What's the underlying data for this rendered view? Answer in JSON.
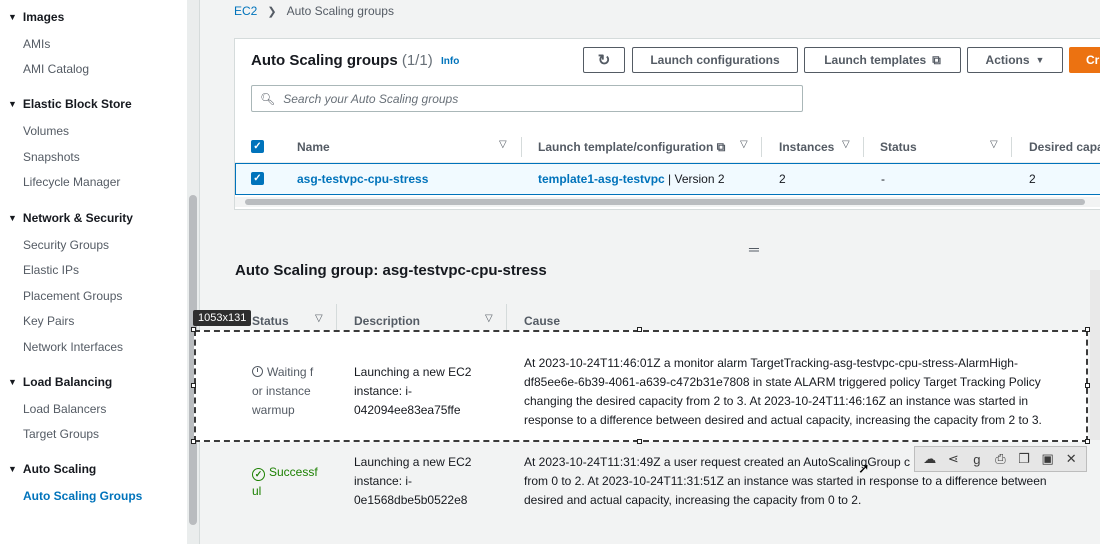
{
  "sidebar": {
    "sections": [
      {
        "label": "Images",
        "items": [
          "AMIs",
          "AMI Catalog"
        ]
      },
      {
        "label": "Elastic Block Store",
        "items": [
          "Volumes",
          "Snapshots",
          "Lifecycle Manager"
        ]
      },
      {
        "label": "Network & Security",
        "items": [
          "Security Groups",
          "Elastic IPs",
          "Placement Groups",
          "Key Pairs",
          "Network Interfaces"
        ]
      },
      {
        "label": "Load Balancing",
        "items": [
          "Load Balancers",
          "Target Groups"
        ]
      },
      {
        "label": "Auto Scaling",
        "items": [
          "Auto Scaling Groups"
        ]
      }
    ]
  },
  "breadcrumb": {
    "root": "EC2",
    "current": "Auto Scaling groups"
  },
  "panel": {
    "title": "Auto Scaling groups",
    "count": "(1/1)",
    "info": "Info",
    "buttons": {
      "launch_configurations": "Launch configurations",
      "launch_templates": "Launch templates",
      "actions": "Actions",
      "create": "Cr"
    },
    "search_placeholder": "Search your Auto Scaling groups",
    "columns": [
      "Name",
      "Launch template/configuration",
      "Instances",
      "Status",
      "Desired capa"
    ],
    "row": {
      "name": "asg-testvpc-cpu-stress",
      "template": "template1-asg-testvpc",
      "version": " | Version 2",
      "instances": "2",
      "status": "-",
      "desired": "2"
    }
  },
  "detail": {
    "title": "Auto Scaling group: asg-testvpc-cpu-stress",
    "columns": [
      "Status",
      "Description",
      "Cause"
    ],
    "rows": [
      {
        "status_lines": [
          "Waiting f",
          "or instance",
          "warmup"
        ],
        "description_lines": [
          "Launching a new EC2",
          "instance: i-",
          "042094ee83ea75ffe"
        ],
        "cause_lines": [
          "At 2023-10-24T11:46:01Z a monitor alarm TargetTracking-asg-testvpc-cpu-stress-AlarmHigh-",
          "df85ee6e-6b39-4061-a639-c472b31e7808 in state ALARM triggered policy Target Tracking Policy",
          "changing the desired capacity from 2 to 3. At 2023-10-24T11:46:16Z an instance was started in",
          "response to a difference between desired and actual capacity, increasing the capacity from 2 to 3."
        ]
      },
      {
        "status_lines": [
          "Successf",
          "ul"
        ],
        "description_lines": [
          "Launching a new EC2",
          "instance: i-",
          "0e1568dbe5b0522e8"
        ],
        "cause_lines": [
          "At 2023-10-24T11:31:49Z a user request created an AutoScalingGroup c",
          "from 0 to 2. At 2023-10-24T11:31:51Z an instance was started in response to a difference between",
          "desired and actual capacity, increasing the capacity from 0 to 2."
        ]
      }
    ]
  },
  "snip": {
    "dimensions": "1053x131"
  },
  "colors": {
    "accent": "#0073bb",
    "primary": "#ec7211",
    "success": "#1d8102"
  }
}
